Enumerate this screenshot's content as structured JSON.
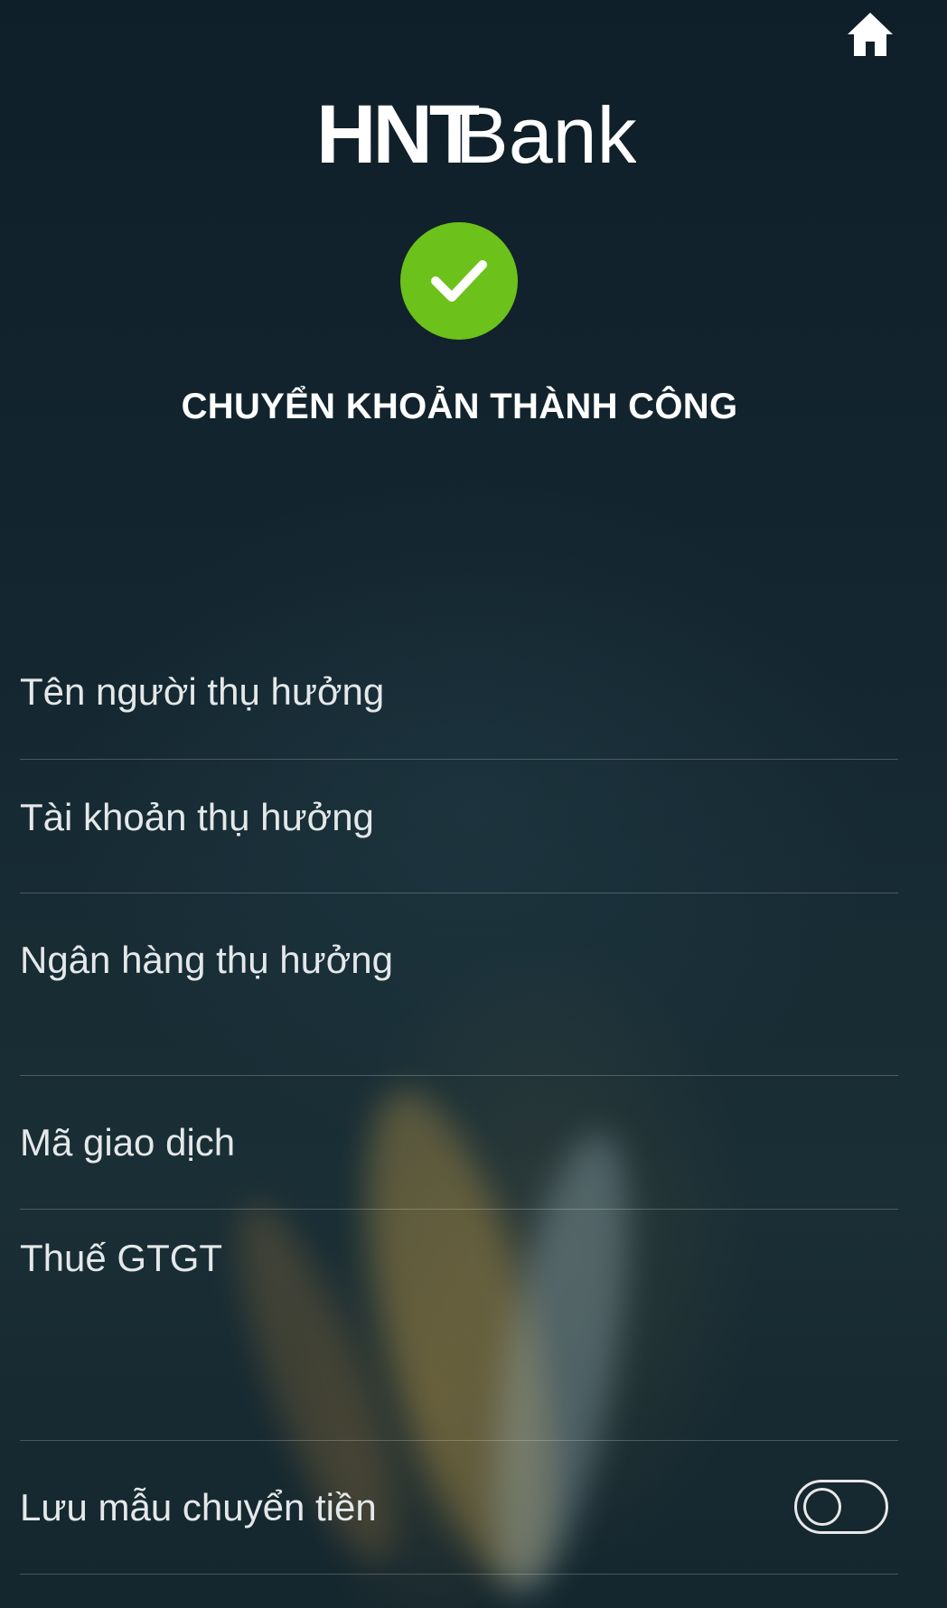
{
  "header": {
    "home_icon": "home-icon",
    "logo_text_a": "HNT",
    "logo_text_b": "Bank"
  },
  "status": {
    "icon": "check-icon",
    "icon_color": "#6cc11a",
    "title": "CHUYỂN KHOẢN THÀNH CÔNG"
  },
  "details": {
    "rows": [
      {
        "label": "Tên người thụ hưởng"
      },
      {
        "label": "Tài khoản thụ hưởng"
      },
      {
        "label": "Ngân hàng thụ hưởng"
      },
      {
        "label": "Mã giao dịch"
      },
      {
        "label": "Thuế GTGT"
      }
    ]
  },
  "save_template": {
    "label": "Lưu mẫu chuyển tiền",
    "toggle_on": false
  },
  "colors": {
    "background": "#10212c",
    "accent_green": "#6cc11a",
    "divider": "rgba(255,255,255,0.22)"
  }
}
